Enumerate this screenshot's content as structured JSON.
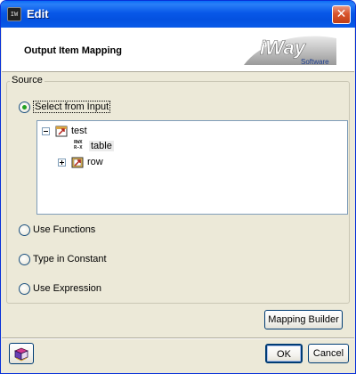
{
  "window": {
    "title": "Edit",
    "app_icon_text": "IW",
    "close_glyph": "✕"
  },
  "header": {
    "title": "Output Item Mapping",
    "logo_main": "iWay",
    "logo_sub": "Software"
  },
  "source": {
    "legend": "Source",
    "options": [
      {
        "label": "Select from Input",
        "checked": true
      },
      {
        "label": "Use Functions",
        "checked": false
      },
      {
        "label": "Type in Constant",
        "checked": false
      },
      {
        "label": "Use Expression",
        "checked": false
      }
    ]
  },
  "tree": {
    "nodes": [
      {
        "label": "test",
        "icon": "table-link-icon",
        "expander": "collapse"
      },
      {
        "label": "table",
        "icon": "rwx-attribute-icon",
        "rwx_top": "RWX",
        "rwx_bottom": "R-X",
        "selected": true
      },
      {
        "label": "row",
        "icon": "element-link-icon",
        "expander": "expand"
      }
    ]
  },
  "buttons": {
    "mapping_builder": "Mapping Builder",
    "ok": "OK",
    "cancel": "Cancel"
  },
  "colors": {
    "title_bar": "#0858e8",
    "radio_checked": "#21a121",
    "window_bg": "#ece9d8"
  }
}
